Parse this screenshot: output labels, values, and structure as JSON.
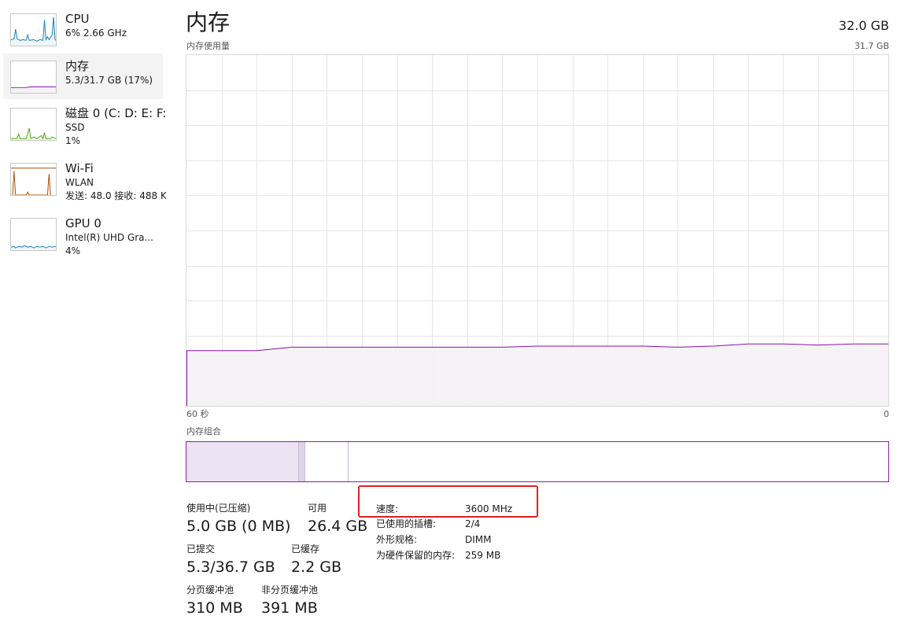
{
  "sidebar": {
    "items": [
      {
        "title": "CPU",
        "line1": "6%  2.66 GHz",
        "line2": "",
        "graph_color": "#117dbb",
        "graph_fill": "#f1f6fa"
      },
      {
        "title": "内存",
        "line1": "5.3/31.7 GB (17%)",
        "line2": "",
        "graph_color": "#8b12ae",
        "graph_fill": "#f4f2f4"
      },
      {
        "title": "磁盘 0 (C: D: E: F:",
        "line1": "SSD",
        "line2": "1%",
        "graph_color": "#4da60c",
        "graph_fill": "#eff7ea"
      },
      {
        "title": "Wi-Fi",
        "line1": "WLAN",
        "line2": "发送: 48.0  接收: 488 K",
        "graph_color": "#a74f01",
        "graph_fill": "#fcf3eb"
      },
      {
        "title": "GPU 0",
        "line1": "Intel(R) UHD Gra...",
        "line2": "4%",
        "graph_color": "#117dbb",
        "graph_fill": "#f1f6fa"
      }
    ]
  },
  "header": {
    "title": "内存",
    "total": "32.0 GB",
    "usage_label": "内存使用量",
    "max_label": "31.7 GB"
  },
  "graph": {
    "time_left": "60 秒",
    "time_right": "0",
    "line_color": "#8b12ae",
    "fill_color": "#f4f2f4",
    "grid_color": "#e6e6e6"
  },
  "chart_data": {
    "type": "area",
    "xlabel": "",
    "ylabel": "",
    "x": [
      0,
      3,
      6,
      9,
      12,
      15,
      18,
      21,
      24,
      27,
      30,
      33,
      36,
      39,
      42,
      45,
      48,
      51,
      54,
      57,
      60
    ],
    "values": [
      5.0,
      5.0,
      5.0,
      5.3,
      5.3,
      5.3,
      5.3,
      5.3,
      5.3,
      5.3,
      5.4,
      5.4,
      5.4,
      5.4,
      5.3,
      5.4,
      5.6,
      5.6,
      5.5,
      5.6,
      5.6
    ],
    "ylim": [
      0,
      31.7
    ],
    "xlim": [
      0,
      60
    ]
  },
  "composition": {
    "label": "内存组合",
    "border_color": "#8b1fa5"
  },
  "stats": {
    "in_use_label": "使用中(已压缩)",
    "in_use_value": "5.0 GB (0 MB)",
    "available_label": "可用",
    "available_value": "26.4 GB",
    "committed_label": "已提交",
    "committed_value": "5.3/36.7 GB",
    "cached_label": "已缓存",
    "cached_value": "2.2 GB",
    "paged_label": "分页缓冲池",
    "paged_value": "310 MB",
    "nonpaged_label": "非分页缓冲池",
    "nonpaged_value": "391 MB"
  },
  "info": {
    "speed_key": "速度:",
    "speed_val": "3600 MHz",
    "slots_key": "已使用的插槽:",
    "slots_val": "2/4",
    "form_key": "外形规格:",
    "form_val": "DIMM",
    "reserved_key": "为硬件保留的内存:",
    "reserved_val": "259 MB"
  },
  "annotation": {
    "highlight_color": "#e02020"
  }
}
